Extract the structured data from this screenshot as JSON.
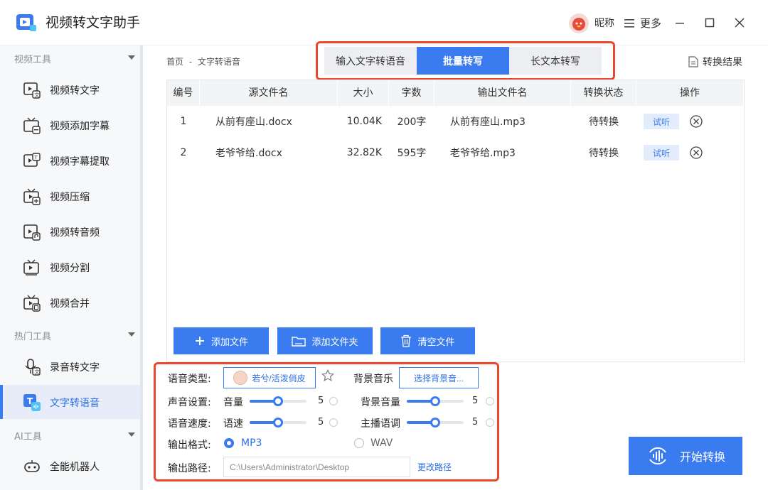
{
  "app": {
    "title": "视频转文字助手"
  },
  "titlebar": {
    "nickname": "昵称",
    "more": "更多"
  },
  "sidebar": {
    "groups": [
      {
        "title": "视频工具"
      },
      {
        "title": "热门工具"
      },
      {
        "title": "AI工具"
      }
    ],
    "items": [
      {
        "label": "视频转文字",
        "icon": "video-text-icon"
      },
      {
        "label": "视频添加字幕",
        "icon": "tv-subtitle-icon"
      },
      {
        "label": "视频字幕提取",
        "icon": "tv-extract-icon"
      },
      {
        "label": "视频压缩",
        "icon": "tv-compress-icon"
      },
      {
        "label": "视频转音频",
        "icon": "video-audio-icon"
      },
      {
        "label": "视频分割",
        "icon": "tv-split-icon"
      },
      {
        "label": "视频合并",
        "icon": "tv-merge-icon"
      },
      {
        "label": "录音转文字",
        "icon": "mic-text-icon"
      },
      {
        "label": "文字转语音",
        "icon": "text-speech-icon",
        "active": true
      },
      {
        "label": "全能机器人",
        "icon": "robot-icon"
      }
    ]
  },
  "breadcrumb": {
    "home": "首页",
    "sep": "-",
    "current": "文字转语音"
  },
  "tabs": [
    {
      "label": "输入文字转语音"
    },
    {
      "label": "批量转写",
      "active": true
    },
    {
      "label": "长文本转写"
    }
  ],
  "result_link": "转换结果",
  "table": {
    "headers": [
      "编号",
      "源文件名",
      "大小",
      "字数",
      "输出文件名",
      "转换状态",
      "操作"
    ],
    "rows": [
      {
        "no": "1",
        "source": "从前有座山.docx",
        "size": "10.04K",
        "words": "200字",
        "output": "从前有座山.mp3",
        "status": "待转换",
        "action": "试听"
      },
      {
        "no": "2",
        "source": "老爷爷给.docx",
        "size": "32.82K",
        "words": "595字",
        "output": "老爷爷给.mp3",
        "status": "待转换",
        "action": "试听"
      }
    ]
  },
  "buttons": {
    "add_file": "添加文件",
    "add_folder": "添加文件夹",
    "clear": "清空文件",
    "start": "开始转换"
  },
  "settings": {
    "voice_type_label": "语音类型:",
    "voice_value": "若兮/活泼俏皮",
    "bgm_label": "背景音乐",
    "bgm_button": "选择背景音...",
    "sound_label": "声音设置:",
    "volume_label": "音量",
    "volume_value": "5",
    "volume_level": 0.5,
    "bg_volume_label": "背景音量",
    "bg_volume_value": "5",
    "bg_volume_level": 0.5,
    "speed_section_label": "语音速度:",
    "speed_label": "语速",
    "speed_value": "5",
    "speed_level": 0.5,
    "pitch_label": "主播语调",
    "pitch_value": "5",
    "pitch_level": 0.5,
    "format_label": "输出格式:",
    "format_mp3": "MP3",
    "format_wav": "WAV",
    "format_selected": "MP3",
    "path_label": "输出路径:",
    "path_value": "C:\\Users\\Administrator\\Desktop",
    "change_path": "更改路径"
  },
  "colors": {
    "accent": "#3b7bf0",
    "highlight": "#e8482f"
  }
}
